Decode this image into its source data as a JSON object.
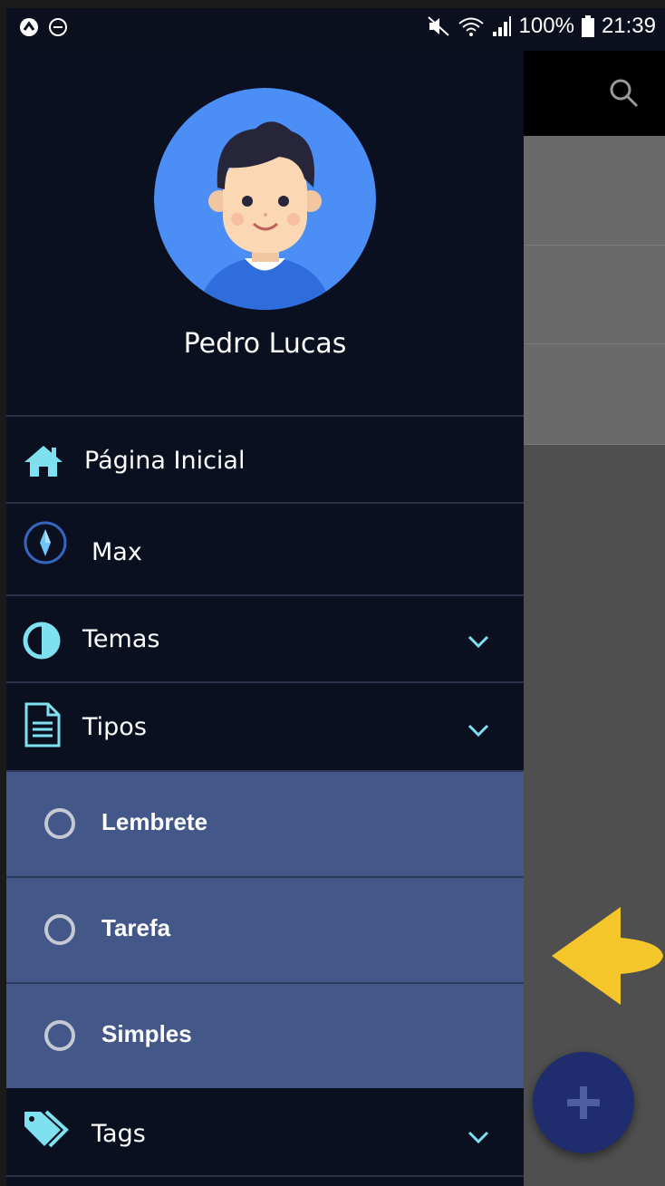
{
  "status_bar": {
    "battery": "100%",
    "time": "21:39"
  },
  "drawer": {
    "user_name": "Pedro Lucas",
    "menu": [
      {
        "label": "Página Inicial",
        "icon": "home-icon"
      },
      {
        "label": "Max",
        "icon": "compass-icon"
      },
      {
        "label": "Temas",
        "icon": "contrast-icon",
        "expandable": true
      },
      {
        "label": "Tipos",
        "icon": "document-icon",
        "expandable": true,
        "expanded": true
      },
      {
        "label": "Tags",
        "icon": "tag-icon",
        "expandable": true
      }
    ],
    "tipos_options": [
      {
        "label": "Lembrete"
      },
      {
        "label": "Tarefa"
      },
      {
        "label": "Simples"
      }
    ]
  },
  "colors": {
    "drawer_bg": "#0b1021",
    "submenu_bg": "#435889",
    "accent_icon": "#7fe0ef",
    "fab_bg": "#1f2d6e",
    "arrow": "#f5c62a",
    "avatar_bg": "#4b8ef5"
  }
}
